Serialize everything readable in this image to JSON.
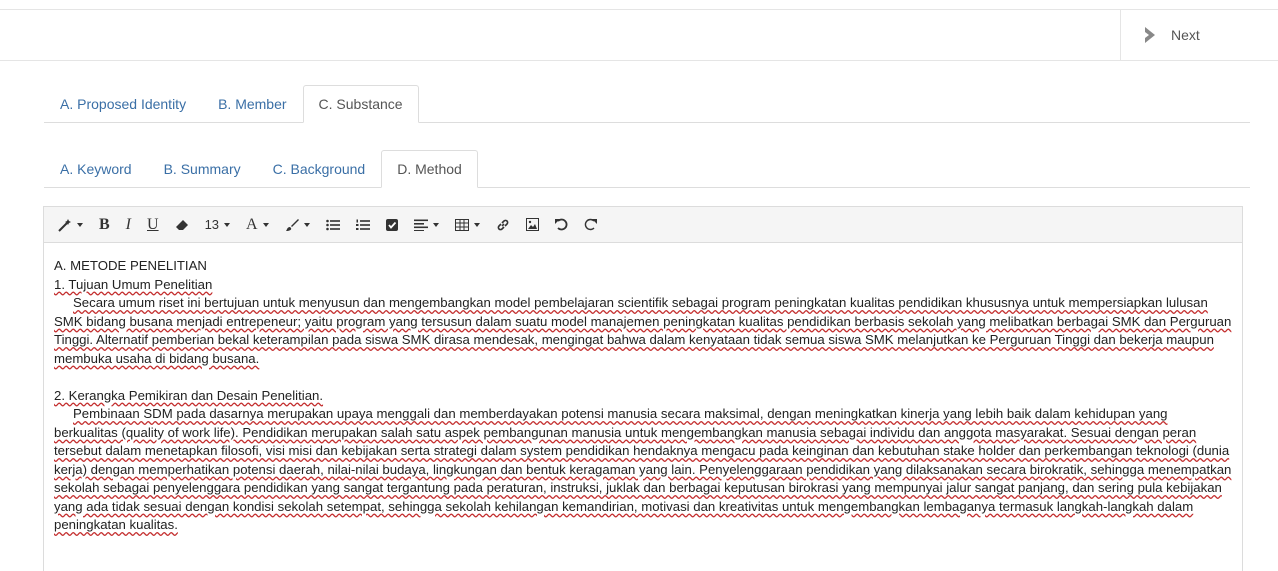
{
  "topbar": {
    "next_label": "Next"
  },
  "tabs_main": [
    {
      "label": "A. Proposed Identity",
      "active": false
    },
    {
      "label": "B. Member",
      "active": false
    },
    {
      "label": "C. Substance",
      "active": true
    }
  ],
  "tabs_sub": [
    {
      "label": "A. Keyword",
      "active": false
    },
    {
      "label": "B. Summary",
      "active": false
    },
    {
      "label": "C. Background",
      "active": false
    },
    {
      "label": "D. Method",
      "active": true
    }
  ],
  "toolbar": {
    "bold": "B",
    "italic": "I",
    "underline": "U",
    "font_size": "13",
    "font_color": "A",
    "icons": [
      "magic-icon",
      "bold-icon",
      "italic-icon",
      "underline-icon",
      "eraser-icon",
      "font-size-select",
      "font-color-icon",
      "brush-icon",
      "unordered-list-icon",
      "ordered-list-icon",
      "checkbox-icon",
      "align-icon",
      "table-icon",
      "link-icon",
      "picture-icon",
      "undo-icon",
      "redo-icon"
    ]
  },
  "content": {
    "heading": "A. METODE PENELITIAN",
    "item1_title": "1. Tujuan Umum Penelitian",
    "para1": "Secara umum riset ini bertujuan untuk menyusun dan mengembangkan model pembelajaran scientifik sebagai program peningkatan kualitas pendidikan khususnya untuk mempersiapkan lulusan SMK bidang busana menjadi  entrepeneur;  yaitu program yang tersusun  dalam suatu model manajemen peningkatan kualitas  pendidikan berbasis sekolah yang melibatkan berbagai SMK dan  Perguruan Tinggi.  Alternatif pemberian bekal keterampilan pada siswa SMK dirasa mendesak, mengingat bahwa dalam kenyataan tidak semua siswa SMK melanjutkan ke Perguruan Tinggi dan bekerja maupun membuka usaha di bidang busana.",
    "item2_title": "2. Kerangka Pemikiran dan Desain Penelitian.",
    "para2": "Pembinaan SDM pada dasarnya merupakan upaya menggali dan memberdayakan potensi manusia secara maksimal, dengan meningkatkan kinerja yang lebih baik dalam kehidupan yang berkualitas (quality of work life). Pendidikan merupakan salah satu aspek pembangunan manusia untuk mengembangkan  manusia sebagai individu dan anggota masyarakat.  Sesuai dengan peran tersebut dalam  menetapkan filosofi, visi misi dan kebijakan serta strategi dalam system pendidikan hendaknya mengacu pada keinginan dan kebutuhan stake holder dan perkembangan teknologi (dunia kerja)  dengan memperhatikan potensi daerah, nilai-nilai budaya, lingkungan dan bentuk keragaman yang lain. Penyelenggaraan pendidikan yang dilaksanakan secara birokratik, sehingga menempatkan  sekolah sebagai penyelenggara  pendidikan yang sangat tergantung pada peraturan, instruksi, juklak dan berbagai keputusan birokrasi yang mempunyai jalur sangat panjang, dan sering pula kebijakan yang ada tidak sesuai dengan kondisi sekolah setempat, sehingga sekolah kehilangan kemandirian, motivasi dan kreativitas untuk mengembangkan lembaganya termasuk  langkah-langkah dalam peningkatan kualitas."
  }
}
